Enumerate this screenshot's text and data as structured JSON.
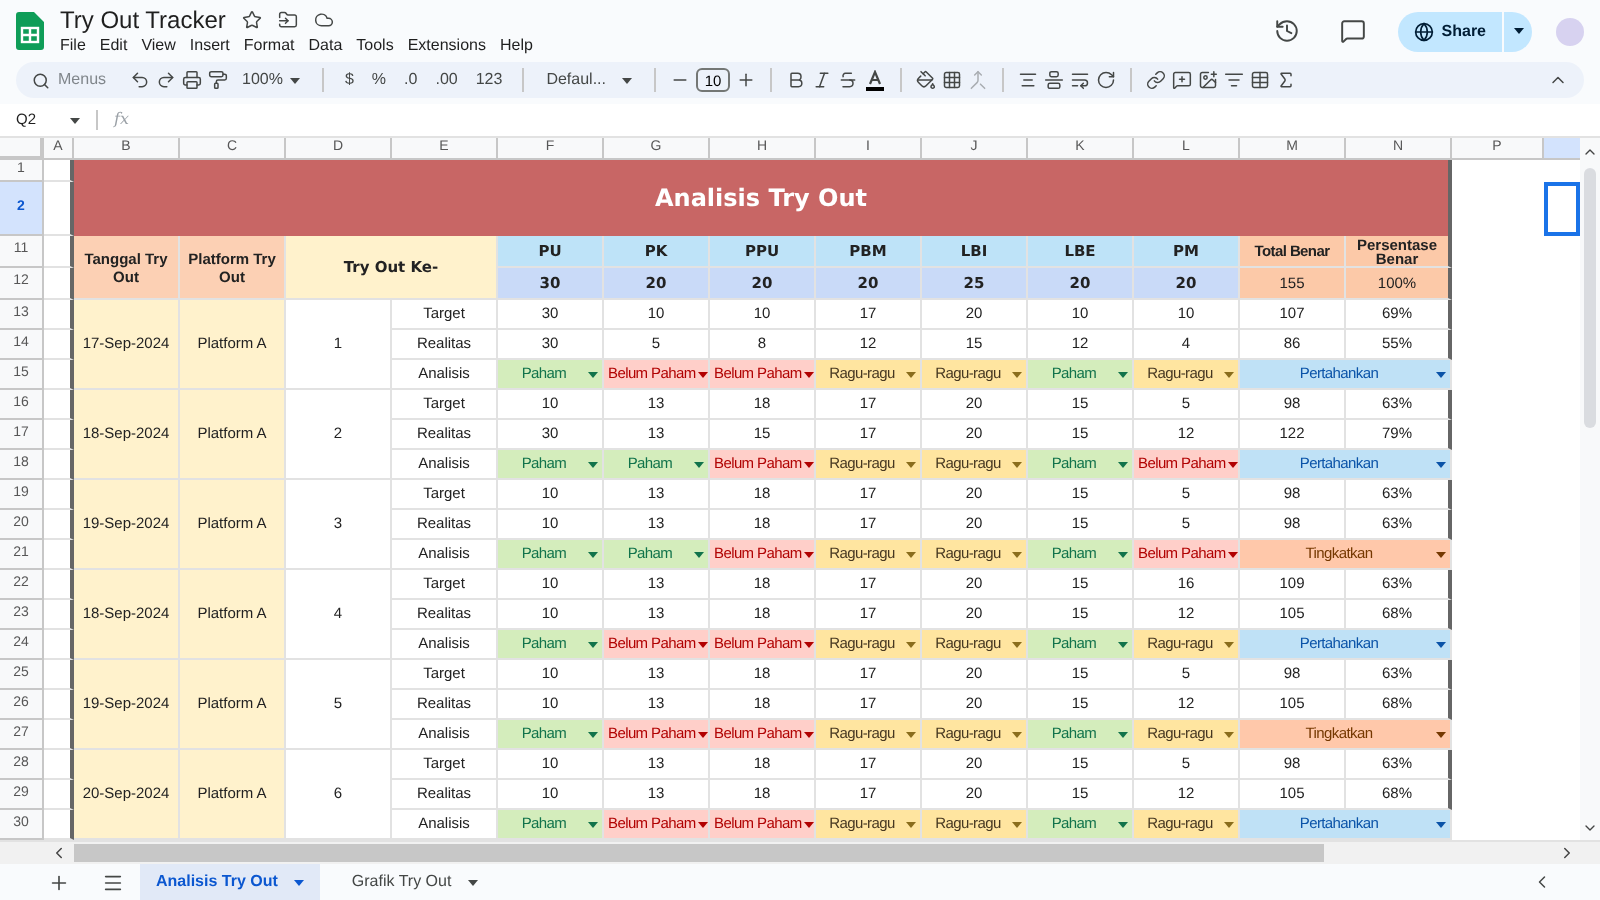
{
  "app": {
    "title": "Try Out Tracker",
    "menu": [
      "File",
      "Edit",
      "View",
      "Insert",
      "Format",
      "Data",
      "Tools",
      "Extensions",
      "Help"
    ],
    "share": "Share"
  },
  "toolbar": {
    "search_placeholder": "Menus",
    "zoom": "100%",
    "currency": "$",
    "percent": "%",
    "decrease_decimals": ".0",
    "increase_decimals": ".00",
    "number_format": "123",
    "font": "Defaul...",
    "font_size": "10"
  },
  "formula_bar": {
    "cell": "Q2",
    "fx": "fx"
  },
  "sheet": {
    "column_letters": [
      "A",
      "B",
      "C",
      "D",
      "E",
      "F",
      "G",
      "H",
      "I",
      "J",
      "K",
      "L",
      "M",
      "N",
      "P"
    ],
    "row_numbers": [
      "1",
      "2",
      "11",
      "12",
      "13",
      "14",
      "15",
      "16",
      "17",
      "18",
      "19",
      "20",
      "21",
      "22",
      "23",
      "24",
      "25",
      "26",
      "27",
      "28",
      "29",
      "30"
    ],
    "title": "Analisis Try Out",
    "headers": {
      "date": "Tanggal Try Out",
      "platform": "Platform Try Out",
      "attempt": "Try Out Ke-",
      "total": "Total Benar",
      "percent": "Persentase Benar"
    },
    "subjects": [
      {
        "name": "PU",
        "max": "30"
      },
      {
        "name": "PK",
        "max": "20"
      },
      {
        "name": "PPU",
        "max": "20"
      },
      {
        "name": "PBM",
        "max": "20"
      },
      {
        "name": "LBI",
        "max": "25"
      },
      {
        "name": "LBE",
        "max": "20"
      },
      {
        "name": "PM",
        "max": "20"
      }
    ],
    "max_total": "155",
    "max_percent": "100%",
    "groups": [
      {
        "date": "17-Sep-2024",
        "platform": "Platform A",
        "attempt": "1",
        "rows": [
          {
            "label": "Target",
            "values": [
              "30",
              "10",
              "10",
              "17",
              "20",
              "10",
              "10"
            ],
            "total": "107",
            "percent": "69%"
          },
          {
            "label": "Realitas",
            "values": [
              "30",
              "5",
              "8",
              "12",
              "15",
              "12",
              "4"
            ],
            "total": "86",
            "percent": "55%"
          }
        ],
        "analysis": {
          "label": "Analisis",
          "items": [
            {
              "text": "Paham",
              "kind": "paham"
            },
            {
              "text": "Belum Paham",
              "kind": "belum"
            },
            {
              "text": "Belum Paham",
              "kind": "belum"
            },
            {
              "text": "Ragu-ragu",
              "kind": "ragu"
            },
            {
              "text": "Ragu-ragu",
              "kind": "ragu"
            },
            {
              "text": "Paham",
              "kind": "paham"
            },
            {
              "text": "Ragu-ragu",
              "kind": "ragu"
            }
          ],
          "recommendation": {
            "text": "Pertahankan",
            "kind": "keep"
          }
        }
      },
      {
        "date": "18-Sep-2024",
        "platform": "Platform A",
        "attempt": "2",
        "rows": [
          {
            "label": "Target",
            "values": [
              "10",
              "13",
              "18",
              "17",
              "20",
              "15",
              "5"
            ],
            "total": "98",
            "percent": "63%"
          },
          {
            "label": "Realitas",
            "values": [
              "30",
              "13",
              "15",
              "17",
              "20",
              "15",
              "12"
            ],
            "total": "122",
            "percent": "79%"
          }
        ],
        "analysis": {
          "label": "Analisis",
          "items": [
            {
              "text": "Paham",
              "kind": "paham"
            },
            {
              "text": "Paham",
              "kind": "paham"
            },
            {
              "text": "Belum Paham",
              "kind": "belum"
            },
            {
              "text": "Ragu-ragu",
              "kind": "ragu"
            },
            {
              "text": "Ragu-ragu",
              "kind": "ragu"
            },
            {
              "text": "Paham",
              "kind": "paham"
            },
            {
              "text": "Belum Paham",
              "kind": "belum"
            }
          ],
          "recommendation": {
            "text": "Pertahankan",
            "kind": "keep"
          }
        }
      },
      {
        "date": "19-Sep-2024",
        "platform": "Platform A",
        "attempt": "3",
        "rows": [
          {
            "label": "Target",
            "values": [
              "10",
              "13",
              "18",
              "17",
              "20",
              "15",
              "5"
            ],
            "total": "98",
            "percent": "63%"
          },
          {
            "label": "Realitas",
            "values": [
              "10",
              "13",
              "18",
              "17",
              "20",
              "15",
              "5"
            ],
            "total": "98",
            "percent": "63%"
          }
        ],
        "analysis": {
          "label": "Analisis",
          "items": [
            {
              "text": "Paham",
              "kind": "paham"
            },
            {
              "text": "Paham",
              "kind": "paham"
            },
            {
              "text": "Belum Paham",
              "kind": "belum"
            },
            {
              "text": "Ragu-ragu",
              "kind": "ragu"
            },
            {
              "text": "Ragu-ragu",
              "kind": "ragu"
            },
            {
              "text": "Paham",
              "kind": "paham"
            },
            {
              "text": "Belum Paham",
              "kind": "belum"
            }
          ],
          "recommendation": {
            "text": "Tingkatkan",
            "kind": "improve"
          }
        }
      },
      {
        "date": "18-Sep-2024",
        "platform": "Platform A",
        "attempt": "4",
        "rows": [
          {
            "label": "Target",
            "values": [
              "10",
              "13",
              "18",
              "17",
              "20",
              "15",
              "16"
            ],
            "total": "109",
            "percent": "63%"
          },
          {
            "label": "Realitas",
            "values": [
              "10",
              "13",
              "18",
              "17",
              "20",
              "15",
              "12"
            ],
            "total": "105",
            "percent": "68%"
          }
        ],
        "analysis": {
          "label": "Analisis",
          "items": [
            {
              "text": "Paham",
              "kind": "paham"
            },
            {
              "text": "Belum Paham",
              "kind": "belum"
            },
            {
              "text": "Belum Paham",
              "kind": "belum"
            },
            {
              "text": "Ragu-ragu",
              "kind": "ragu"
            },
            {
              "text": "Ragu-ragu",
              "kind": "ragu"
            },
            {
              "text": "Paham",
              "kind": "paham"
            },
            {
              "text": "Ragu-ragu",
              "kind": "ragu"
            }
          ],
          "recommendation": {
            "text": "Pertahankan",
            "kind": "keep"
          }
        }
      },
      {
        "date": "19-Sep-2024",
        "platform": "Platform A",
        "attempt": "5",
        "rows": [
          {
            "label": "Target",
            "values": [
              "10",
              "13",
              "18",
              "17",
              "20",
              "15",
              "5"
            ],
            "total": "98",
            "percent": "63%"
          },
          {
            "label": "Realitas",
            "values": [
              "10",
              "13",
              "18",
              "17",
              "20",
              "15",
              "12"
            ],
            "total": "105",
            "percent": "68%"
          }
        ],
        "analysis": {
          "label": "Analisis",
          "items": [
            {
              "text": "Paham",
              "kind": "paham"
            },
            {
              "text": "Belum Paham",
              "kind": "belum"
            },
            {
              "text": "Belum Paham",
              "kind": "belum"
            },
            {
              "text": "Ragu-ragu",
              "kind": "ragu"
            },
            {
              "text": "Ragu-ragu",
              "kind": "ragu"
            },
            {
              "text": "Paham",
              "kind": "paham"
            },
            {
              "text": "Ragu-ragu",
              "kind": "ragu"
            }
          ],
          "recommendation": {
            "text": "Tingkatkan",
            "kind": "improve"
          }
        }
      },
      {
        "date": "20-Sep-2024",
        "platform": "Platform A",
        "attempt": "6",
        "rows": [
          {
            "label": "Target",
            "values": [
              "10",
              "13",
              "18",
              "17",
              "20",
              "15",
              "5"
            ],
            "total": "98",
            "percent": "63%"
          },
          {
            "label": "Realitas",
            "values": [
              "10",
              "13",
              "18",
              "17",
              "20",
              "15",
              "12"
            ],
            "total": "105",
            "percent": "68%"
          }
        ],
        "analysis": {
          "label": "Analisis",
          "items": [
            {
              "text": "Paham",
              "kind": "paham"
            },
            {
              "text": "Belum Paham",
              "kind": "belum"
            },
            {
              "text": "Belum Paham",
              "kind": "belum"
            },
            {
              "text": "Ragu-ragu",
              "kind": "ragu"
            },
            {
              "text": "Ragu-ragu",
              "kind": "ragu"
            },
            {
              "text": "Paham",
              "kind": "paham"
            },
            {
              "text": "Ragu-ragu",
              "kind": "ragu"
            }
          ],
          "recommendation": {
            "text": "Pertahankan",
            "kind": "keep"
          }
        }
      }
    ]
  },
  "sheet_tabs": [
    {
      "label": "Analisis Try Out",
      "selected": true
    },
    {
      "label": "Grafik Try Out",
      "selected": false
    }
  ]
}
